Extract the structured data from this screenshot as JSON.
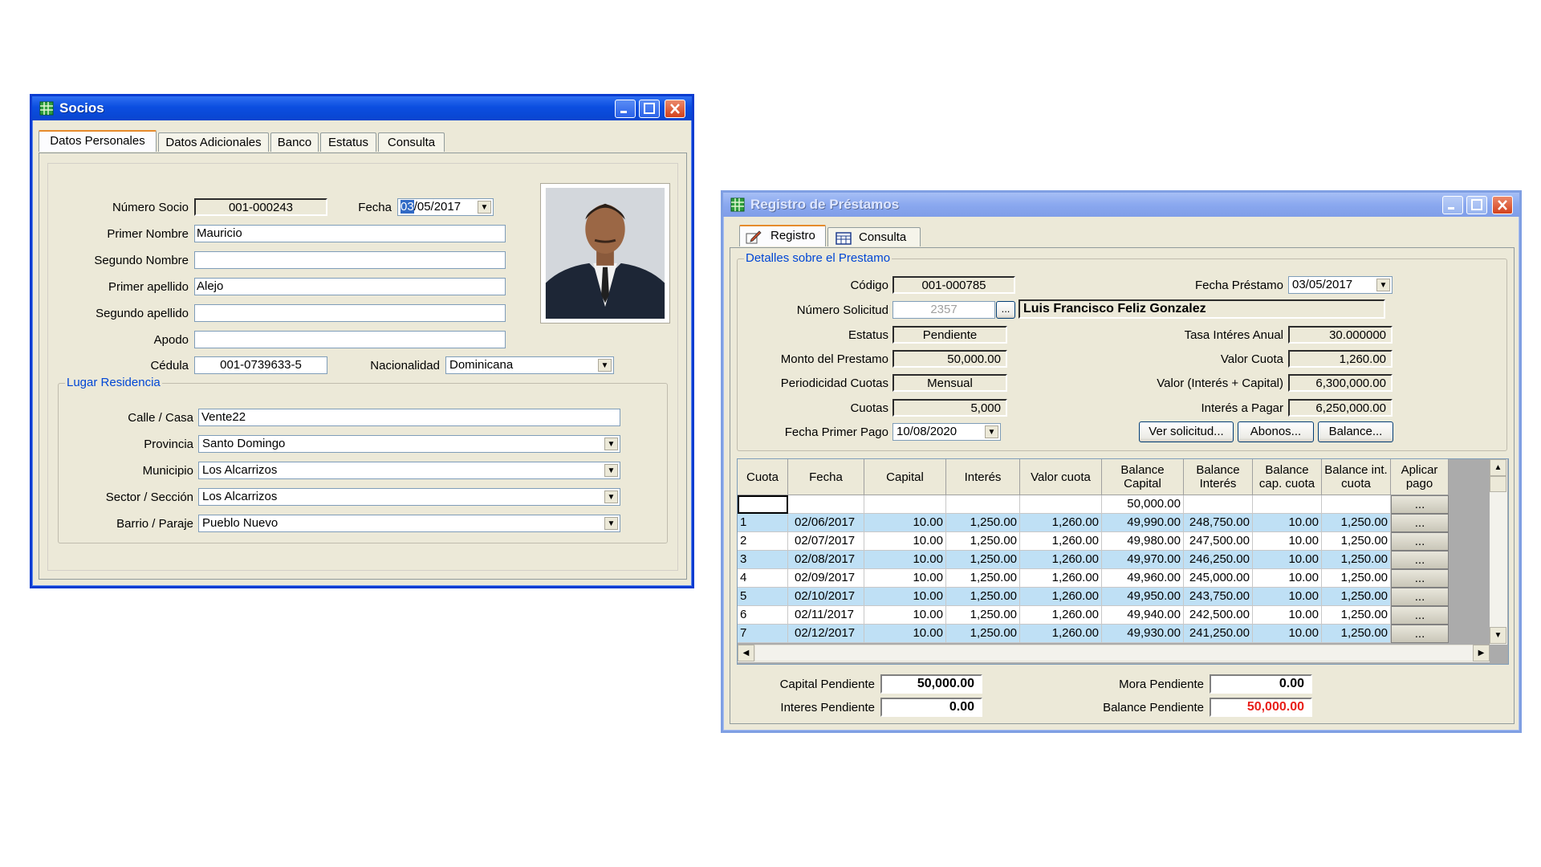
{
  "socios": {
    "title": "Socios",
    "tabs": [
      {
        "label": "Datos Personales"
      },
      {
        "label": "Datos Adicionales"
      },
      {
        "label": "Banco"
      },
      {
        "label": "Estatus"
      },
      {
        "label": "Consulta"
      }
    ],
    "numero_socio": {
      "label": "Número Socio",
      "value": "001-000243"
    },
    "fecha": {
      "label": "Fecha",
      "value_sel": "03",
      "value_rest": "/05/2017"
    },
    "primer_nombre": {
      "label": "Primer Nombre",
      "value": "Mauricio"
    },
    "segundo_nombre": {
      "label": "Segundo Nombre",
      "value": ""
    },
    "primer_apellido": {
      "label": "Primer apellido",
      "value": "Alejo"
    },
    "segundo_apellido": {
      "label": "Segundo apellido",
      "value": ""
    },
    "apodo": {
      "label": "Apodo",
      "value": ""
    },
    "cedula": {
      "label": "Cédula",
      "value": "001-0739633-5"
    },
    "nacionalidad": {
      "label": "Nacionalidad",
      "value": "Dominicana"
    },
    "lugar": {
      "title": "Lugar Residencia",
      "calle": {
        "label": "Calle / Casa",
        "value": "Vente22"
      },
      "provincia": {
        "label": "Provincia",
        "value": "Santo Domingo"
      },
      "municipio": {
        "label": "Municipio",
        "value": "Los Alcarrizos"
      },
      "sector": {
        "label": "Sector / Sección",
        "value": "Los Alcarrizos"
      },
      "barrio": {
        "label": "Barrio / Paraje",
        "value": "Pueblo Nuevo"
      }
    }
  },
  "prestamos": {
    "title": "Registro de Préstamos",
    "tabs": [
      {
        "label": "Registro"
      },
      {
        "label": "Consulta"
      }
    ],
    "group_title": "Detalles sobre el Prestamo",
    "codigo": {
      "label": "Código",
      "value": "001-000785"
    },
    "numero_solicitud": {
      "label": "Número Solicitud",
      "value": "2357",
      "browse": "..."
    },
    "cliente": "Luis Francisco Feliz Gonzalez",
    "estatus": {
      "label": "Estatus",
      "value": "Pendiente"
    },
    "monto": {
      "label": "Monto del Prestamo",
      "value": "50,000.00"
    },
    "periodicidad": {
      "label": "Periodicidad Cuotas",
      "value": "Mensual"
    },
    "cuotas": {
      "label": "Cuotas",
      "value": "5,000"
    },
    "fecha_primer_pago": {
      "label": "Fecha Primer Pago",
      "value": "10/08/2020"
    },
    "fecha_prestamo": {
      "label": "Fecha Préstamo",
      "value": "03/05/2017"
    },
    "tasa": {
      "label": "Tasa Intéres Anual",
      "value": "30.000000"
    },
    "valor_cuota": {
      "label": "Valor Cuota",
      "value": "1,260.00"
    },
    "valor_total": {
      "label": "Valor (Interés + Capital)",
      "value": "6,300,000.00"
    },
    "interes_pagar": {
      "label": "Interés a Pagar",
      "value": "6,250,000.00"
    },
    "buttons": {
      "ver": "Ver solicitud...",
      "abonos": "Abonos...",
      "balance": "Balance..."
    },
    "table": {
      "headers": [
        "Cuota",
        "Fecha",
        "Capital",
        "Interés",
        "Valor cuota",
        "Balance Capital",
        "Balance Interés",
        "Balance cap. cuota",
        "Balance int. cuota",
        "Aplicar pago"
      ],
      "initial_balance": "50,000.00",
      "apply_label": "...",
      "rows": [
        [
          "1",
          "02/06/2017",
          "10.00",
          "1,250.00",
          "1,260.00",
          "49,990.00",
          "248,750.00",
          "10.00",
          "1,250.00"
        ],
        [
          "2",
          "02/07/2017",
          "10.00",
          "1,250.00",
          "1,260.00",
          "49,980.00",
          "247,500.00",
          "10.00",
          "1,250.00"
        ],
        [
          "3",
          "02/08/2017",
          "10.00",
          "1,250.00",
          "1,260.00",
          "49,970.00",
          "246,250.00",
          "10.00",
          "1,250.00"
        ],
        [
          "4",
          "02/09/2017",
          "10.00",
          "1,250.00",
          "1,260.00",
          "49,960.00",
          "245,000.00",
          "10.00",
          "1,250.00"
        ],
        [
          "5",
          "02/10/2017",
          "10.00",
          "1,250.00",
          "1,260.00",
          "49,950.00",
          "243,750.00",
          "10.00",
          "1,250.00"
        ],
        [
          "6",
          "02/11/2017",
          "10.00",
          "1,250.00",
          "1,260.00",
          "49,940.00",
          "242,500.00",
          "10.00",
          "1,250.00"
        ],
        [
          "7",
          "02/12/2017",
          "10.00",
          "1,250.00",
          "1,260.00",
          "49,930.00",
          "241,250.00",
          "10.00",
          "1,250.00"
        ]
      ]
    },
    "totals": {
      "capital_pendiente": {
        "label": "Capital Pendiente",
        "value": "50,000.00"
      },
      "interes_pendiente": {
        "label": "Interes Pendiente",
        "value": "0.00"
      },
      "mora_pendiente": {
        "label": "Mora Pendiente",
        "value": "0.00"
      },
      "balance_pendiente": {
        "label": "Balance Pendiente",
        "value": "50,000.00"
      }
    }
  },
  "colors": {
    "title_active": "#0b4ee0",
    "title_inactive": "#8aa8ef",
    "group_title": "#0046d5",
    "row_highlight": "#bfe0f5",
    "balance_red": "#e8201a"
  }
}
